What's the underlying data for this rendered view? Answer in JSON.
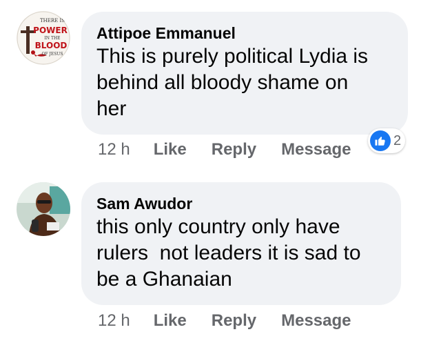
{
  "comments": [
    {
      "author": "Attipoe Emmanuel",
      "text": "This is purely political Lydia is\nbehind all bloody shame on\nher",
      "avatar_text": [
        "THERE IS",
        "POWER",
        "IN THE",
        "BLOOD",
        "OF JESUS"
      ],
      "time": "12 h",
      "like_label": "Like",
      "reply_label": "Reply",
      "message_label": "Message",
      "reaction_count": "2",
      "reaction_icon": "like-icon"
    },
    {
      "author": "Sam Awudor",
      "text": "this only country only have\nrulers  not leaders it is sad to\nbe a Ghanaian",
      "time": "12 h",
      "like_label": "Like",
      "reply_label": "Reply",
      "message_label": "Message"
    }
  ],
  "colors": {
    "bubble": "#f0f2f5",
    "text": "#050505",
    "meta": "#65676b",
    "like_blue": "#1877f2"
  }
}
